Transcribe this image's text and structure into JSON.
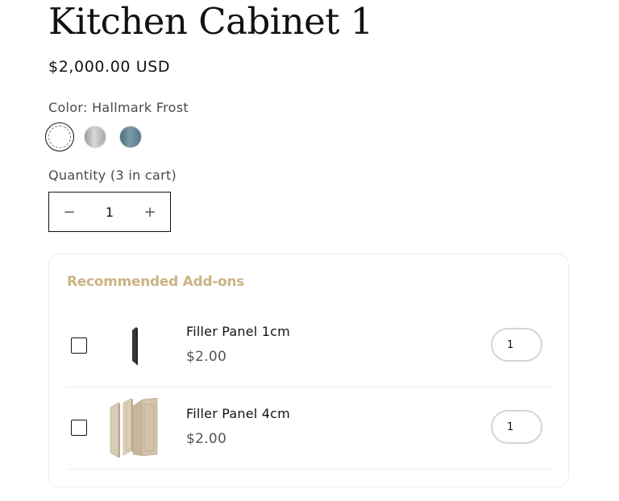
{
  "product": {
    "title": "Kitchen Cabinet 1",
    "price": "$2,000.00 USD",
    "color_label": "Color: Hallmark Frost",
    "swatches": [
      {
        "name": "Hallmark Frost",
        "color": "#ffffff",
        "selected": true
      },
      {
        "name": "Grey",
        "color": "#b5b5b5",
        "selected": false
      },
      {
        "name": "Blue",
        "color": "#62808f",
        "selected": false
      }
    ],
    "quantity_label": "Quantity (3 in cart)",
    "quantity": {
      "decrease": "−",
      "value": "1",
      "increase": "+"
    }
  },
  "addons": {
    "title": "Recommended Add-ons",
    "accent_color": "#cbb385",
    "items": [
      {
        "name": "Filler Panel 1cm",
        "price": "$2.00",
        "qty": "1",
        "checked": false,
        "image": "dark-filler-panel"
      },
      {
        "name": "Filler Panel 4cm",
        "price": "$2.00",
        "qty": "1",
        "checked": false,
        "image": "beige-filler-panels"
      }
    ]
  }
}
